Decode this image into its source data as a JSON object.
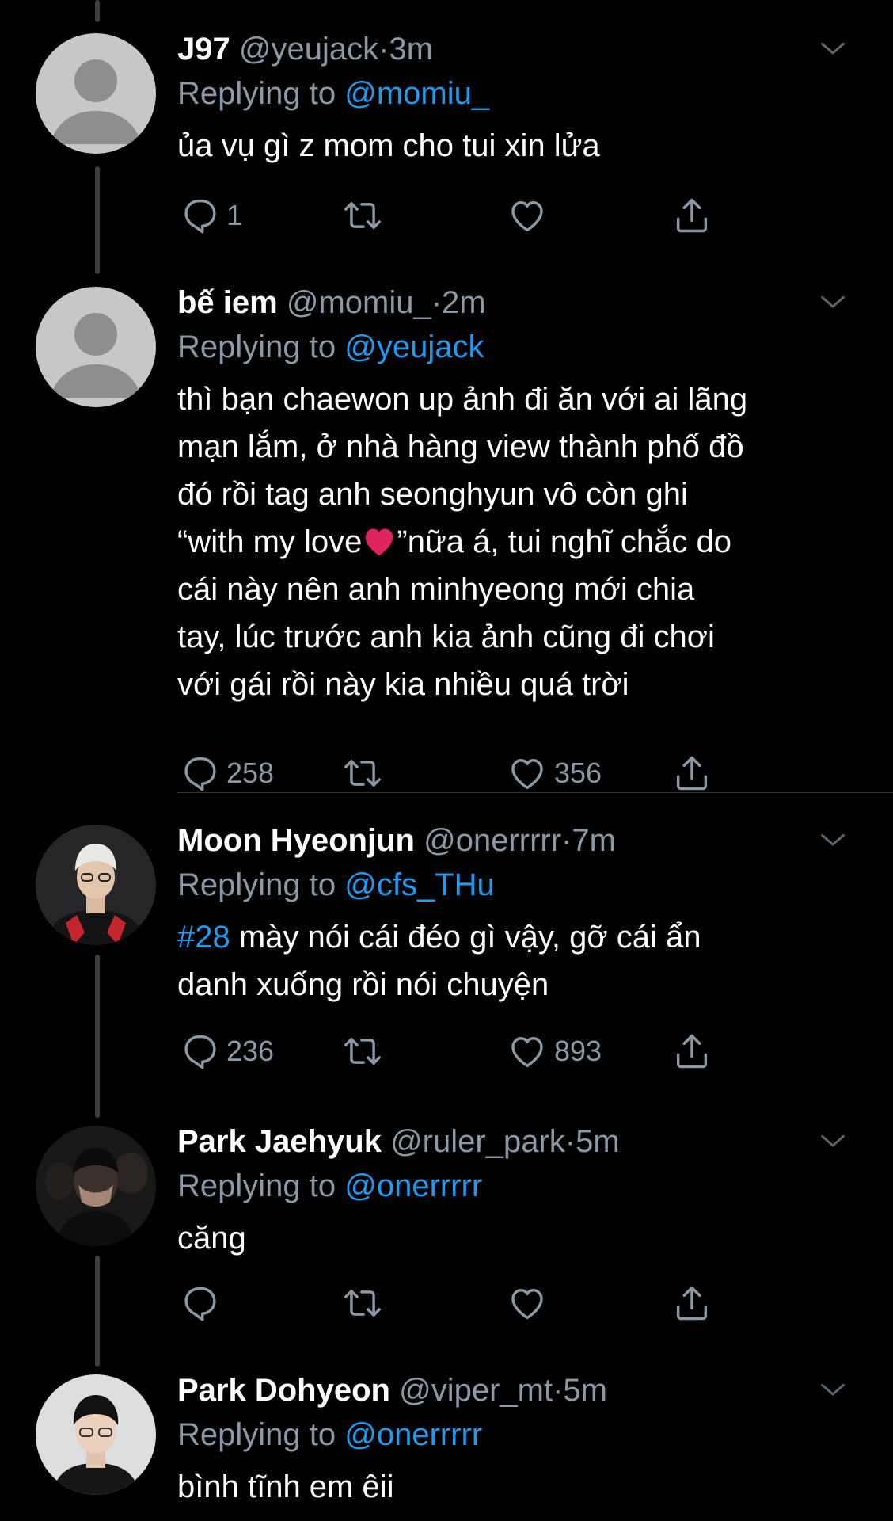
{
  "tweets": [
    {
      "name": "J97",
      "handle": "@yeujack",
      "dot": "·",
      "time": "3m",
      "reply_prefix": "Replying to ",
      "reply_to": "@momiu_",
      "text": "ủa vụ gì z mom cho tui xin lửa",
      "replies": "1",
      "retweets": "",
      "likes": "",
      "avatar": "default-avatar"
    },
    {
      "name": "bế iem",
      "handle": "@momiu_",
      "dot": "·",
      "time": "2m",
      "reply_prefix": "Replying to ",
      "reply_to": "@yeujack",
      "text_lines": [
        "thì bạn chaewon up ảnh đi ăn với ai lãng",
        "mạn lắm, ở nhà hàng view thành phố đồ",
        "đó rồi tag anh seonghyun vô còn ghi",
        "“with my love",
        "”nữa á, tui nghĩ chắc do",
        "cái này nên anh minhyeong mới chia",
        "tay, lúc trước anh kia ảnh cũng đi chơi",
        "với gái rồi này kia nhiều quá trời"
      ],
      "replies": "258",
      "retweets": "",
      "likes": "356",
      "avatar": "default-avatar"
    },
    {
      "name": "Moon Hyeonjun",
      "handle": "@onerrrrr",
      "dot": "·",
      "time": "7m",
      "reply_prefix": "Replying to ",
      "reply_to": "@cfs_THu",
      "hashtag": "#28",
      "text_line1": " mày nói cái đéo gì vậy, gỡ cái ẩn",
      "text_line2": "danh xuống rồi nói chuyện",
      "replies": "236",
      "retweets": "",
      "likes": "893",
      "avatar": "photo-avatar"
    },
    {
      "name": "Park Jaehyuk",
      "handle": "@ruler_park",
      "dot": "·",
      "time": "5m",
      "reply_prefix": "Replying to ",
      "reply_to": "@onerrrrr",
      "text": "căng",
      "replies": "",
      "retweets": "",
      "likes": "",
      "avatar": "photo-avatar"
    },
    {
      "name": "Park Dohyeon",
      "handle": "@viper_mt",
      "dot": "·",
      "time": "5m",
      "reply_prefix": "Replying to ",
      "reply_to": "@onerrrrr",
      "text": "bình tĩnh em êii",
      "avatar": "photo-avatar"
    }
  ],
  "colors": {
    "background": "#000000",
    "secondary_text": "#8b98a5",
    "accent": "#1d9bf0",
    "thread_line": "#3a3f44"
  },
  "icons": [
    "reply-icon",
    "retweet-icon",
    "like-icon",
    "share-icon",
    "chevron-down-icon",
    "red-heart-emoji"
  ]
}
